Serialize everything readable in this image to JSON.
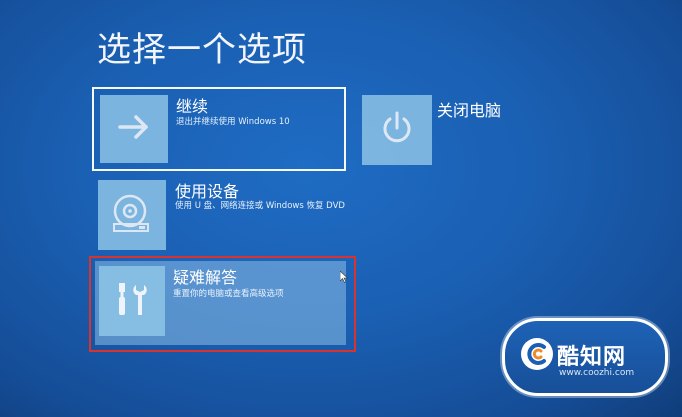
{
  "page": {
    "title": "选择一个选项"
  },
  "options": {
    "continue": {
      "title": "继续",
      "description": "退出并继续使用 Windows 10",
      "icon": "arrow-right-icon"
    },
    "shutdown": {
      "title": "关闭电脑",
      "icon": "power-icon"
    },
    "use_device": {
      "title": "使用设备",
      "description": "使用 U 盘、网络连接或 Windows 恢复 DVD",
      "icon": "disc-drive-icon"
    },
    "troubleshoot": {
      "title": "疑难解答",
      "description": "重置你的电脑或查看高级选项",
      "icon": "tools-icon"
    }
  },
  "watermark": {
    "name": "酷知网",
    "url": "www.coozhi.com"
  },
  "colors": {
    "background": "#1a5fb2",
    "tile": "#8cc3e6",
    "selection_border": "#f4f8ff",
    "highlight_border": "#d8332f"
  }
}
